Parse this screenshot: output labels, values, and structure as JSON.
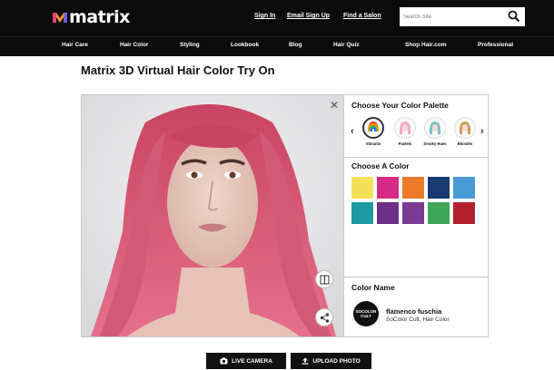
{
  "header": {
    "logo_text": "matrix",
    "links": [
      "Sign In",
      "Email Sign Up",
      "Find a Salon"
    ],
    "search_placeholder": "Search Site"
  },
  "nav": [
    "Hair Care",
    "Hair Color",
    "Styling",
    "Lookbook",
    "Blog",
    "Hair Quiz",
    "Shop Hair.com",
    "Professional"
  ],
  "page_title": "Matrix 3D Virtual Hair Color Try On",
  "panel": {
    "palette_heading": "Choose Your Color Palette",
    "palettes": [
      {
        "label": "Vibrants",
        "icon": "rainbow-hair-icon",
        "selected": true
      },
      {
        "label": "Pastels",
        "icon": "pink-hair-icon",
        "selected": false
      },
      {
        "label": "Smoky Hues",
        "icon": "teal-hair-icon",
        "selected": false
      },
      {
        "label": "Blondes",
        "icon": "blonde-hair-icon",
        "selected": false
      }
    ],
    "color_heading": "Choose A Color",
    "swatches": [
      "#f5e05a",
      "#d52b86",
      "#ec7a2b",
      "#173a73",
      "#4a9ad4",
      "#1f9aa3",
      "#6b2f86",
      "#7a3a92",
      "#3fa559",
      "#b3202f"
    ],
    "color_name_heading": "Color Name",
    "color_name": "flamenco fuschia",
    "color_brand": "SoColor Cult, Hair Color",
    "brand_logo_text": "SOCOLOR CULT"
  },
  "buttons": {
    "live_camera": "LIVE CAMERA",
    "upload_photo": "UPLOAD PHOTO"
  },
  "colors": {
    "hair": "#d9556e",
    "header_bg": "#0b0b0b"
  }
}
